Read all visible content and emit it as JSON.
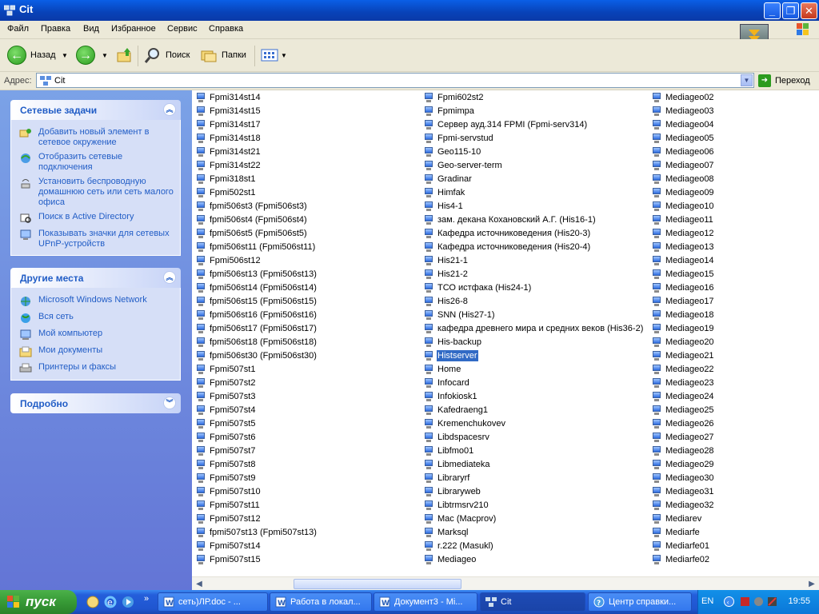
{
  "window": {
    "title": "Cit"
  },
  "menu": [
    "Файл",
    "Правка",
    "Вид",
    "Избранное",
    "Сервис",
    "Справка"
  ],
  "toolbar": {
    "back": "Назад",
    "search": "Поиск",
    "folders": "Папки"
  },
  "address": {
    "label": "Адрес:",
    "value": "Cit",
    "go": "Переход"
  },
  "sidebar": {
    "network_tasks": {
      "title": "Сетевые задачи",
      "items": [
        {
          "label": "Добавить новый элемент в сетевое окружение"
        },
        {
          "label": "Отобразить сетевые подключения"
        },
        {
          "label": "Установить беспроводную домашнюю сеть или сеть малого офиса"
        },
        {
          "label": "Поиск в Active Directory"
        },
        {
          "label": "Показывать значки для сетевых UPnP-устройств"
        }
      ]
    },
    "other_places": {
      "title": "Другие места",
      "items": [
        {
          "label": "Microsoft Windows Network"
        },
        {
          "label": "Вся сеть"
        },
        {
          "label": "Мой компьютер"
        },
        {
          "label": "Мои документы"
        },
        {
          "label": "Принтеры и факсы"
        }
      ]
    },
    "details": {
      "title": "Подробно"
    }
  },
  "files": {
    "col1": [
      "Fpmi314st14",
      "Fpmi314st15",
      "Fpmi314st17",
      "Fpmi314st18",
      "Fpmi314st21",
      "Fpmi314st22",
      "Fpmi318st1",
      "Fpmi502st1",
      "fpmi506st3 (Fpmi506st3)",
      "fpmi506st4 (Fpmi506st4)",
      "fpmi506st5 (Fpmi506st5)",
      "fpmi506st11 (Fpmi506st11)",
      "Fpmi506st12",
      "fpmi506st13 (Fpmi506st13)",
      "fpmi506st14 (Fpmi506st14)",
      "fpmi506st15 (Fpmi506st15)",
      "fpmi506st16 (Fpmi506st16)",
      "fpmi506st17 (Fpmi506st17)",
      "fpmi506st18 (Fpmi506st18)",
      "fpmi506st30 (Fpmi506st30)",
      "Fpmi507st1",
      "Fpmi507st2",
      "Fpmi507st3",
      "Fpmi507st4",
      "Fpmi507st5",
      "Fpmi507st6",
      "Fpmi507st7",
      "Fpmi507st8",
      "Fpmi507st9",
      "Fpmi507st10",
      "Fpmi507st11",
      "Fpmi507st12",
      "fpmi507st13 (Fpmi507st13)",
      "Fpmi507st14",
      "Fpmi507st15"
    ],
    "col2": [
      "Fpmi602st2",
      "Fpmimpa",
      "Сервер ауд.314 FPMI (Fpmi-serv314)",
      "Fpmi-servstud",
      "Geo115-10",
      "Geo-server-term",
      "Gradinar",
      "Himfak",
      "His4-1",
      "зам. декана Кохановский А.Г. (His16-1)",
      "Кафедра источниковедения (His20-3)",
      "Кафедра источниковедения (His20-4)",
      "His21-1",
      "His21-2",
      "ТСО истфака (His24-1)",
      "His26-8",
      "SNN (His27-1)",
      "кафедра древнего мира и средних веков (His36-2)",
      "His-backup",
      "Histserver",
      "Home",
      "Infocard",
      "Infokiosk1",
      "Kafedraeng1",
      "Kremenchukovev",
      "Libdspacesrv",
      "Libfmo01",
      "Libmediateka",
      "Libraryrf",
      "Libraryweb",
      "Libtrmsrv210",
      "Mac (Macprov)",
      "Marksql",
      "r.222 (Masukl)",
      "Mediageo"
    ],
    "col3": [
      "Mediageo02",
      "Mediageo03",
      "Mediageo04",
      "Mediageo05",
      "Mediageo06",
      "Mediageo07",
      "Mediageo08",
      "Mediageo09",
      "Mediageo10",
      "Mediageo11",
      "Mediageo12",
      "Mediageo13",
      "Mediageo14",
      "Mediageo15",
      "Mediageo16",
      "Mediageo17",
      "Mediageo18",
      "Mediageo19",
      "Mediageo20",
      "Mediageo21",
      "Mediageo22",
      "Mediageo23",
      "Mediageo24",
      "Mediageo25",
      "Mediageo26",
      "Mediageo27",
      "Mediageo28",
      "Mediageo29",
      "Mediageo30",
      "Mediageo31",
      "Mediageo32",
      "Mediarev",
      "Mediarfe",
      "Mediarfe01",
      "Mediarfe02"
    ],
    "selected": "Histserver"
  },
  "taskbar": {
    "start": "пуск",
    "buttons": [
      {
        "label": "сеть)ЛР.doc - ...",
        "active": false
      },
      {
        "label": "Работа в локал...",
        "active": false
      },
      {
        "label": "Документ3 - Mi...",
        "active": false
      },
      {
        "label": "Cit",
        "active": true
      },
      {
        "label": "Центр справки...",
        "active": false
      }
    ],
    "lang": "EN",
    "clock": "19:55"
  },
  "colors": {
    "title_blue": "#0842b8",
    "link_blue": "#215dc6",
    "selection": "#316ac5",
    "start_green": "#379a36"
  }
}
